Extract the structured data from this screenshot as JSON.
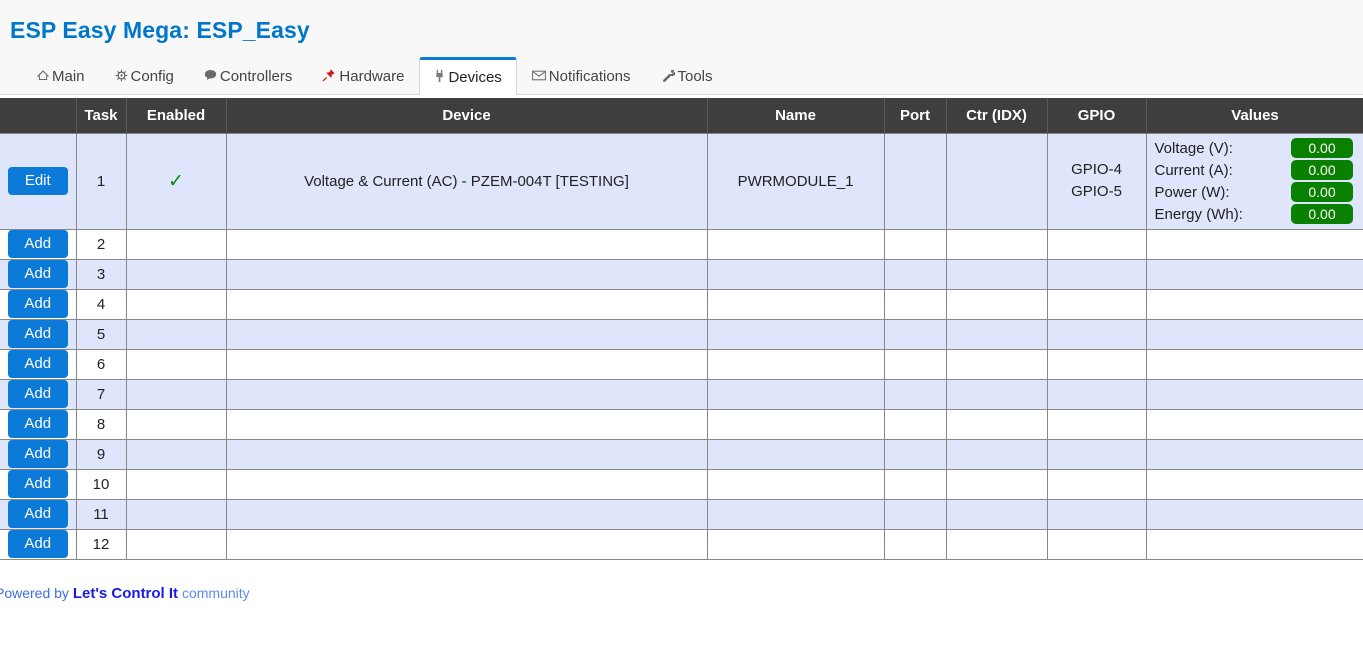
{
  "header": {
    "title": "ESP Easy Mega: ESP_Easy"
  },
  "tabs": [
    {
      "label": "Main",
      "icon": "home-icon",
      "glyph": "⌂",
      "active": false
    },
    {
      "label": "Config",
      "icon": "gear-icon",
      "glyph": "☉",
      "active": false
    },
    {
      "label": "Controllers",
      "icon": "speech-bubble-icon",
      "glyph": "⬤",
      "active": false
    },
    {
      "label": "Hardware",
      "icon": "pushpin-icon",
      "glyph": "⚑",
      "active": false
    },
    {
      "label": "Devices",
      "icon": "plug-icon",
      "glyph": "⑂",
      "active": true
    },
    {
      "label": "Notifications",
      "icon": "envelope-icon",
      "glyph": "✉",
      "active": false
    },
    {
      "label": "Tools",
      "icon": "wrench-icon",
      "glyph": "ὒ7",
      "active": false
    }
  ],
  "table": {
    "columns": [
      "",
      "Task",
      "Enabled",
      "Device",
      "Name",
      "Port",
      "Ctr (IDX)",
      "GPIO",
      "Values"
    ],
    "edit_label": "Edit",
    "add_label": "Add",
    "enabled_mark": "✓",
    "rows": [
      {
        "action": "Edit",
        "task": "1",
        "enabled": true,
        "device": "Voltage & Current (AC) - PZEM-004T [TESTING]",
        "name": "PWRMODULE_1",
        "port": "",
        "ctr_idx": "",
        "gpio": [
          "GPIO-4",
          "GPIO-5"
        ],
        "values": [
          {
            "label": "Voltage (V):",
            "value": "0.00"
          },
          {
            "label": "Current (A):",
            "value": "0.00"
          },
          {
            "label": "Power (W):",
            "value": "0.00"
          },
          {
            "label": "Energy (Wh):",
            "value": "0.00"
          }
        ]
      },
      {
        "action": "Add",
        "task": "2",
        "enabled": false,
        "device": "",
        "name": "",
        "port": "",
        "ctr_idx": "",
        "gpio": [],
        "values": []
      },
      {
        "action": "Add",
        "task": "3",
        "enabled": false,
        "device": "",
        "name": "",
        "port": "",
        "ctr_idx": "",
        "gpio": [],
        "values": []
      },
      {
        "action": "Add",
        "task": "4",
        "enabled": false,
        "device": "",
        "name": "",
        "port": "",
        "ctr_idx": "",
        "gpio": [],
        "values": []
      },
      {
        "action": "Add",
        "task": "5",
        "enabled": false,
        "device": "",
        "name": "",
        "port": "",
        "ctr_idx": "",
        "gpio": [],
        "values": []
      },
      {
        "action": "Add",
        "task": "6",
        "enabled": false,
        "device": "",
        "name": "",
        "port": "",
        "ctr_idx": "",
        "gpio": [],
        "values": []
      },
      {
        "action": "Add",
        "task": "7",
        "enabled": false,
        "device": "",
        "name": "",
        "port": "",
        "ctr_idx": "",
        "gpio": [],
        "values": []
      },
      {
        "action": "Add",
        "task": "8",
        "enabled": false,
        "device": "",
        "name": "",
        "port": "",
        "ctr_idx": "",
        "gpio": [],
        "values": []
      },
      {
        "action": "Add",
        "task": "9",
        "enabled": false,
        "device": "",
        "name": "",
        "port": "",
        "ctr_idx": "",
        "gpio": [],
        "values": []
      },
      {
        "action": "Add",
        "task": "10",
        "enabled": false,
        "device": "",
        "name": "",
        "port": "",
        "ctr_idx": "",
        "gpio": [],
        "values": []
      },
      {
        "action": "Add",
        "task": "11",
        "enabled": false,
        "device": "",
        "name": "",
        "port": "",
        "ctr_idx": "",
        "gpio": [],
        "values": []
      },
      {
        "action": "Add",
        "task": "12",
        "enabled": false,
        "device": "",
        "name": "",
        "port": "",
        "ctr_idx": "",
        "gpio": [],
        "values": []
      }
    ]
  },
  "footer": {
    "prefix": "Powered by ",
    "brand": "Let's Control It",
    "suffix": " community"
  },
  "colors": {
    "accent_blue": "#0b7ad8",
    "title_blue": "#0077cc",
    "header_dark": "#3e3e3e",
    "row_alt": "#dfe5fb",
    "badge_green": "#0a8000",
    "check_green": "#0a8a0a",
    "pin_red": "#cc1d1d"
  }
}
